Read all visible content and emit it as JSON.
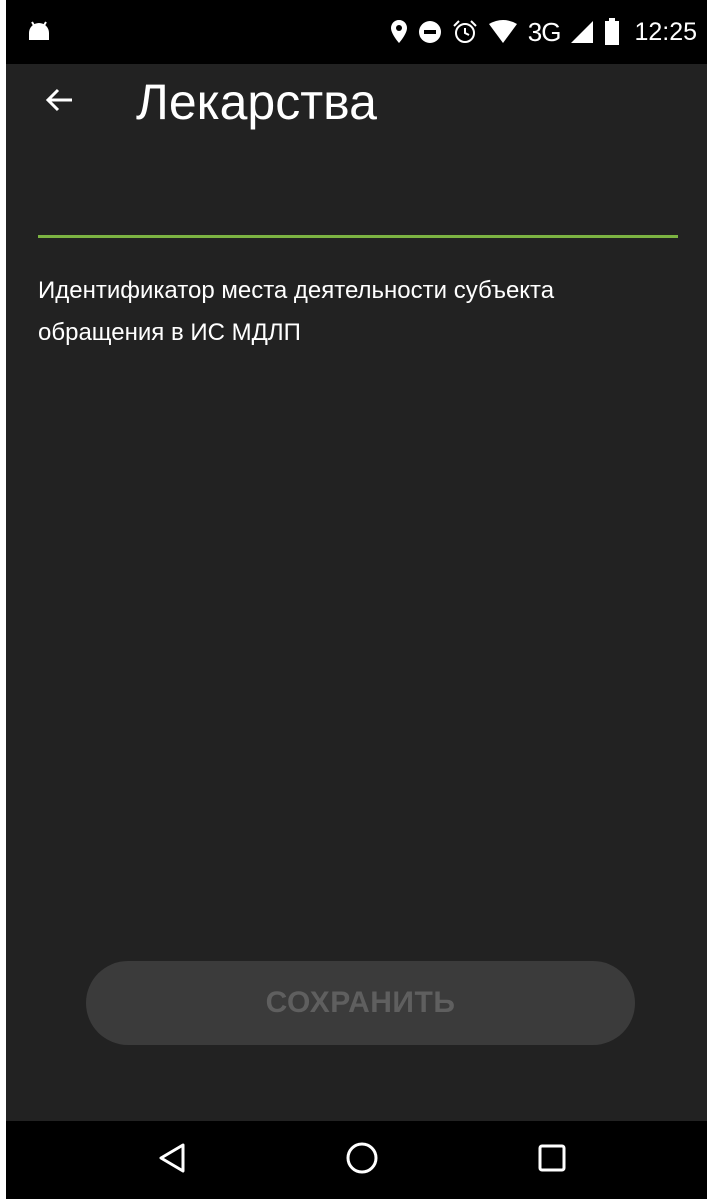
{
  "status_bar": {
    "network_type": "3G",
    "time": "12:25",
    "icons": [
      "android-icon",
      "location-icon",
      "do-not-disturb-icon",
      "alarm-icon",
      "wifi-icon",
      "cell-signal-icon",
      "battery-icon"
    ]
  },
  "app_bar": {
    "back_icon": "arrow-back-icon",
    "title": "Лекарства"
  },
  "form": {
    "input_value": "",
    "underline_color": "#7cb342",
    "label": "Идентификатор места деятельности субъекта обращения в ИС МДЛП"
  },
  "actions": {
    "save_label": "СОХРАНИТЬ",
    "save_disabled": true
  },
  "nav_bar": {
    "icons": [
      "nav-back-icon",
      "nav-home-icon",
      "nav-recents-icon"
    ]
  },
  "colors": {
    "background": "#222222",
    "accent": "#7cb342",
    "button_bg": "#3b3b3b",
    "button_text": "#5f5f5f"
  }
}
